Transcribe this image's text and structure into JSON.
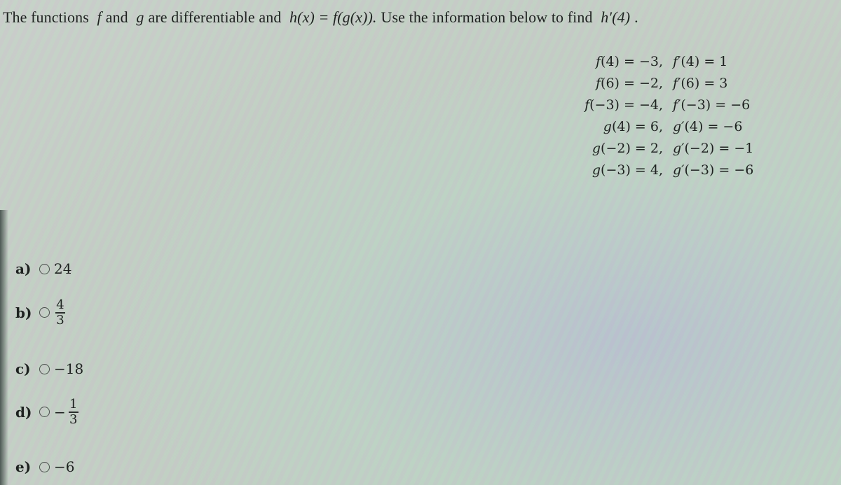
{
  "question": {
    "text_1": "The functions",
    "f": "f",
    "text_2": "and",
    "g": "g",
    "text_3": "are differentiable and",
    "h_def": "h(x) = f(g(x)).",
    "text_4": "Use the information below to find",
    "target": "h′(4)",
    "text_5": "."
  },
  "given": [
    {
      "lhs_fn": "f",
      "lhs": "(4) = −3,",
      "rhs_fn": "f′",
      "rhs": "(4) = 1"
    },
    {
      "lhs_fn": "f",
      "lhs": "(6) = −2,",
      "rhs_fn": "f′",
      "rhs": "(6) = 3"
    },
    {
      "lhs_fn": "f",
      "lhs": "(−3) = −4,",
      "rhs_fn": "f′",
      "rhs": "(−3) = −6"
    },
    {
      "lhs_fn": "g",
      "lhs": "(4) = 6,",
      "rhs_fn": "g′",
      "rhs": "(4) = −6"
    },
    {
      "lhs_fn": "g",
      "lhs": "(−2) = 2,",
      "rhs_fn": "g′",
      "rhs": "(−2) = −1"
    },
    {
      "lhs_fn": "g",
      "lhs": "(−3) = 4,",
      "rhs_fn": "g′",
      "rhs": "(−3) = −6"
    }
  ],
  "choices": [
    {
      "letter": "a)",
      "value": "24",
      "selected": false
    },
    {
      "letter": "b)",
      "numerator": "4",
      "denominator": "3",
      "selected": false
    },
    {
      "letter": "c)",
      "value": "−18",
      "selected": false
    },
    {
      "letter": "d)",
      "sign": "−",
      "numerator": "1",
      "denominator": "3",
      "selected": false
    },
    {
      "letter": "e)",
      "value": "−6",
      "selected": false
    }
  ]
}
